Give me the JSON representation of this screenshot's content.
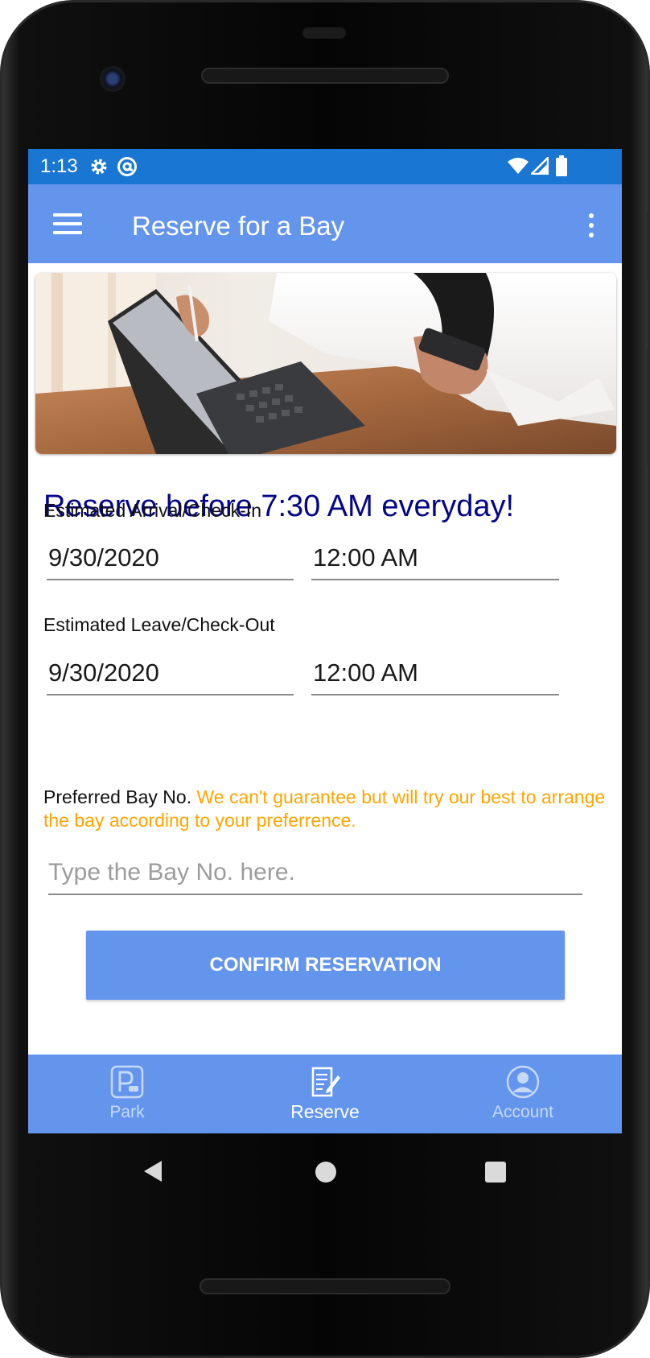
{
  "status": {
    "time": "1:13"
  },
  "appbar": {
    "title": "Reserve for a Bay"
  },
  "form": {
    "headline": "Reserve before 7:30 AM everyday!",
    "arrival_label": "Estimated Arrival/Check-In",
    "arrival_date": "9/30/2020",
    "arrival_time": "12:00 AM",
    "leave_label": "Estimated Leave/Check-Out",
    "leave_date": "9/30/2020",
    "leave_time": "12:00 AM",
    "bay_label": "Preferred Bay No.",
    "bay_note": "We can't guarantee but will try our best to arrange the bay according to your preferrence.",
    "bay_placeholder": "Type the Bay No. here.",
    "confirm_label": "CONFIRM RESERVATION"
  },
  "bottom_nav": {
    "items": [
      {
        "label": "Park",
        "icon": "parking-icon",
        "active": false
      },
      {
        "label": "Reserve",
        "icon": "reserve-form-icon",
        "active": true
      },
      {
        "label": "Account",
        "icon": "account-icon",
        "active": false
      }
    ]
  },
  "colors": {
    "status_bar": "#1976d2",
    "app_bar": "#6495ed",
    "headline": "#05058a",
    "warning_text": "#ffa500",
    "nav_inactive": "#c8d8f7"
  }
}
